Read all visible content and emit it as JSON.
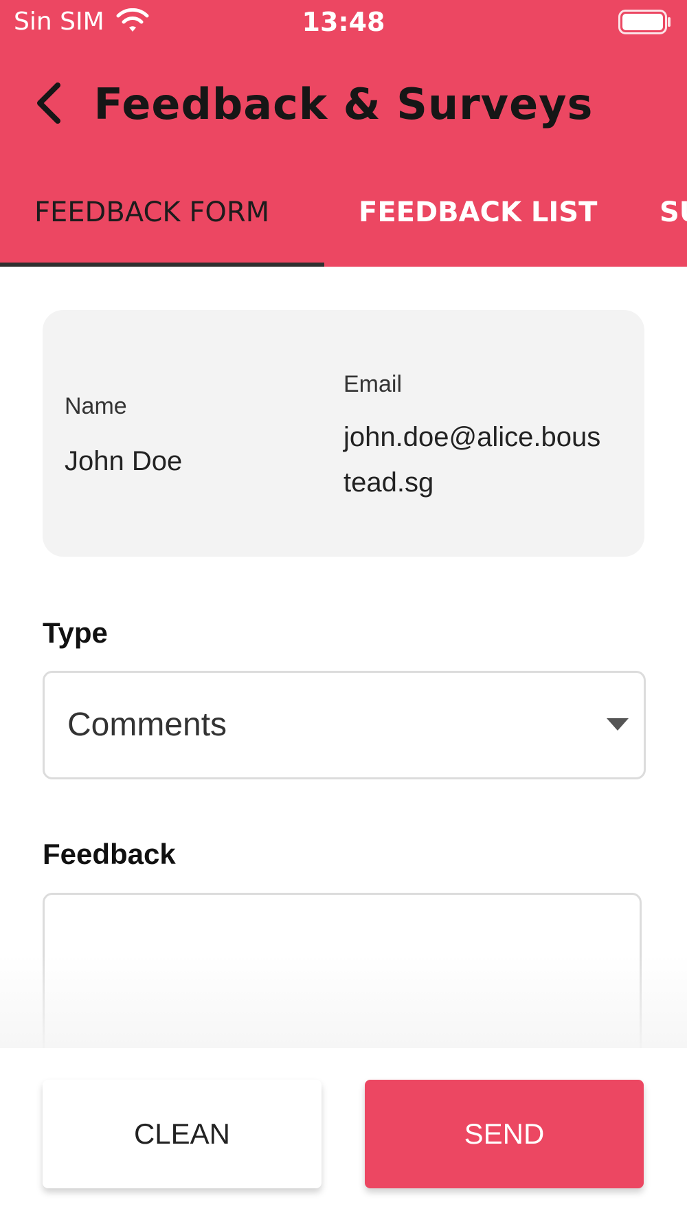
{
  "status_bar": {
    "carrier": "Sin SIM",
    "time": "13:48",
    "icons": [
      "wifi-icon",
      "battery-icon"
    ]
  },
  "header": {
    "title": "Feedback & Surveys",
    "back_icon": "chevron-left-icon",
    "background_color": "#ec4762"
  },
  "tabs": [
    {
      "label": "FEEDBACK FORM",
      "active": true
    },
    {
      "label": "FEEDBACK LIST",
      "active": false
    },
    {
      "label": "SU",
      "active": false
    }
  ],
  "user_card": {
    "name_label": "Name",
    "name_value": "John Doe",
    "email_label": "Email",
    "email_value": "john.doe@alice.boustead.sg"
  },
  "type_field": {
    "label": "Type",
    "selected_value": "Comments"
  },
  "feedback_field": {
    "label": "Feedback",
    "value": ""
  },
  "actions": {
    "clean_label": "CLEAN",
    "send_label": "SEND"
  },
  "colors": {
    "accent": "#ec4762",
    "tab_indicator": "#2f2f2f",
    "card_background": "#f3f3f3"
  }
}
